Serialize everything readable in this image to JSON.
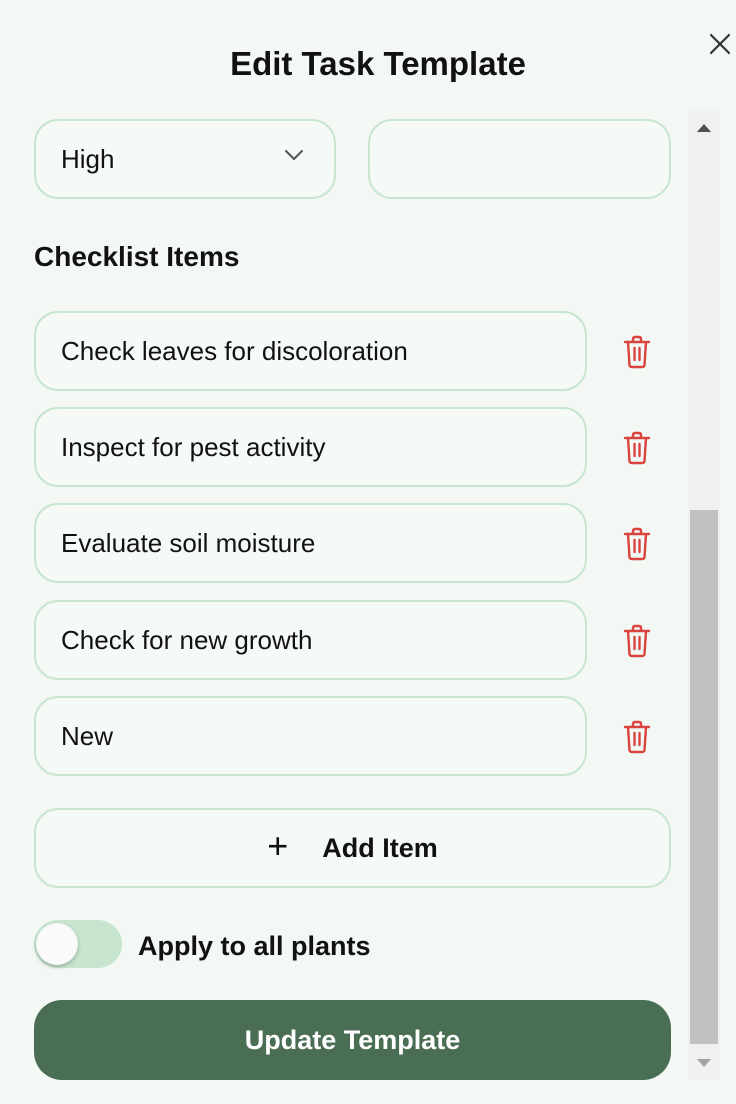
{
  "dialog": {
    "title": "Edit Task Template",
    "close_icon": "close-icon"
  },
  "priority": {
    "value": "High",
    "icon": "chevron-down-icon"
  },
  "second_field": {
    "value": ""
  },
  "checklist": {
    "heading": "Checklist Items",
    "items": [
      {
        "label": "Check leaves for discoloration"
      },
      {
        "label": "Inspect for pest activity"
      },
      {
        "label": "Evaluate soil moisture"
      },
      {
        "label": "Check for new growth"
      },
      {
        "label": "New"
      }
    ],
    "delete_icon": "trash-icon",
    "add_label": "Add Item",
    "add_icon": "+"
  },
  "apply_all": {
    "label": "Apply to all plants",
    "enabled": false
  },
  "submit": {
    "label": "Update Template"
  },
  "colors": {
    "background": "#f3f8f4",
    "border": "#c8e6cf",
    "primary": "#4a6e54",
    "danger": "#d9443f"
  }
}
